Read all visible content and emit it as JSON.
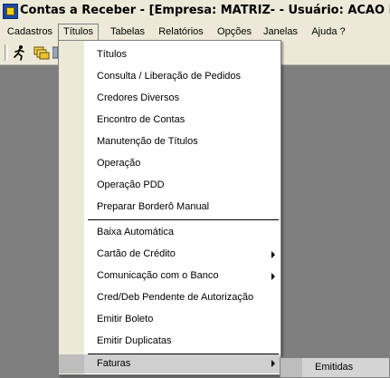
{
  "window": {
    "title": "Contas a Receber - [Empresa: MATRIZ- - Usuário: ACAO INFORMATICA"
  },
  "menubar": {
    "items": [
      {
        "label": "Cadastros"
      },
      {
        "label": "Títulos"
      },
      {
        "label": "Tabelas"
      },
      {
        "label": "Relatórios"
      },
      {
        "label": "Opções"
      },
      {
        "label": "Janelas"
      },
      {
        "label": "Ajuda ?"
      }
    ],
    "open_menu": "Títulos"
  },
  "toolbar": {
    "icons": [
      "runner-icon",
      "folder-stack-icon",
      "document-icon"
    ]
  },
  "titulos_menu": {
    "items": [
      {
        "label": "Títulos"
      },
      {
        "label": "Consulta / Liberação de Pedidos"
      },
      {
        "label": "Credores Diversos"
      },
      {
        "label": "Encontro de Contas"
      },
      {
        "label": "Manutenção de Títulos"
      },
      {
        "label": "Operação"
      },
      {
        "label": "Operação PDD"
      },
      {
        "label": "Preparar Borderô Manual"
      },
      {
        "label": "Baixa Automática"
      },
      {
        "label": "Cartão de Crédito",
        "submenu": true
      },
      {
        "label": "Comunicação com o Banco",
        "submenu": true
      },
      {
        "label": "Cred/Deb Pendente de Autorização"
      },
      {
        "label": "Emitir Boleto"
      },
      {
        "label": "Emitir Duplicatas"
      },
      {
        "label": "Faturas",
        "submenu": true,
        "highlighted": true
      }
    ]
  },
  "faturas_submenu": {
    "items": [
      {
        "label": "Emitidas"
      }
    ]
  },
  "colors": {
    "chrome": "#ece9d8",
    "workspace": "#7f7f7f",
    "menu_background": "#ffffff",
    "highlight": "#cfcfcf"
  }
}
